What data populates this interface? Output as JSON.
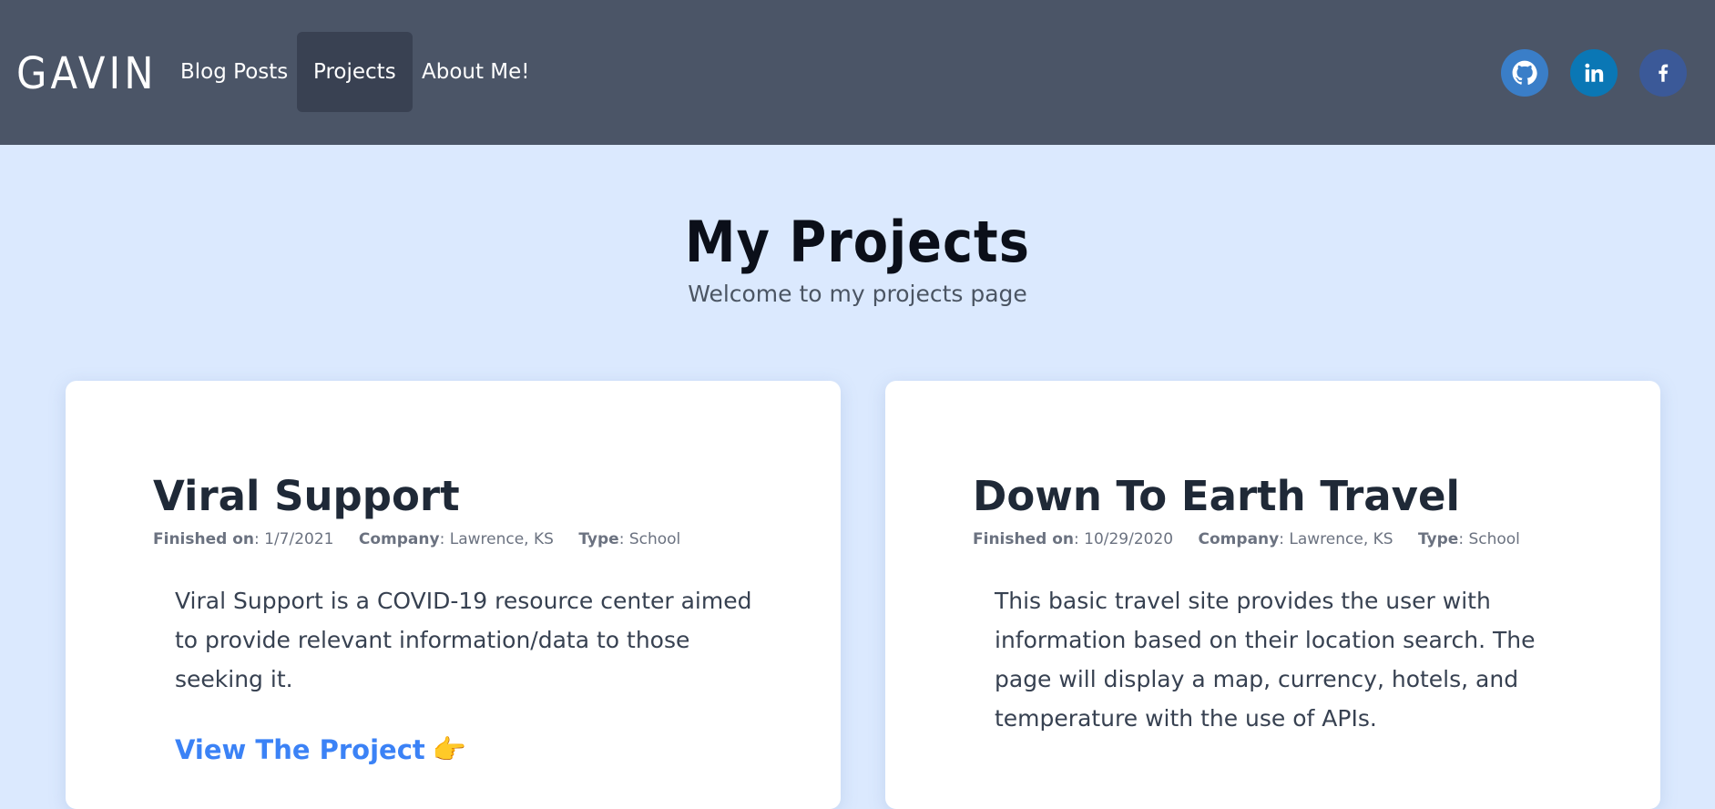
{
  "nav": {
    "brand": "GAVIN",
    "links": [
      {
        "label": "Blog Posts",
        "active": false
      },
      {
        "label": "Projects",
        "active": true
      },
      {
        "label": "About Me!",
        "active": false
      }
    ],
    "social": [
      {
        "icon": "github-icon",
        "color": "#3a7ec8"
      },
      {
        "icon": "linkedin-icon",
        "color": "#0a77b5"
      },
      {
        "icon": "facebook-icon",
        "color": "#3b5998"
      }
    ]
  },
  "hero": {
    "title": "My Projects",
    "subtitle": "Welcome to my projects page"
  },
  "projects": [
    {
      "title": "Viral Support",
      "finished_label": "Finished on",
      "finished": ": 1/7/2021",
      "company_label": "Company",
      "company": ": Lawrence, KS",
      "type_label": "Type",
      "type": ": School",
      "description": "Viral Support is a COVID-19 resource center aimed to provide relevant information/data to those seeking it.",
      "cta": "View The Project",
      "cta_icon": "👉"
    },
    {
      "title": "Down To Earth Travel",
      "finished_label": "Finished on",
      "finished": ": 10/29/2020",
      "company_label": "Company",
      "company": ": Lawrence, KS",
      "type_label": "Type",
      "type": ": School",
      "description": "This basic travel site provides the user with information based on their location search. The page will display a map, currency, hotels, and temperature with the use of APIs."
    }
  ],
  "colors": {
    "navbar": "#4b5567",
    "nav_active": "#394152",
    "page_bg": "#dbe9fe",
    "link": "#3b82f6"
  }
}
